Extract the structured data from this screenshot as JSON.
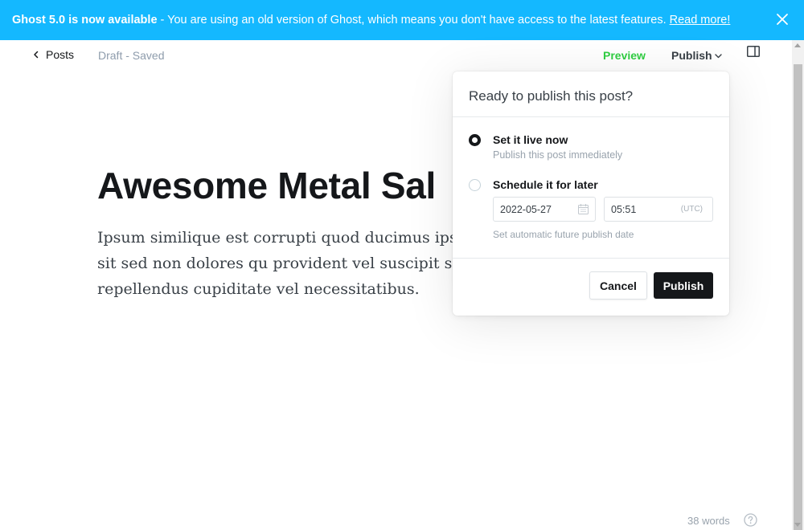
{
  "banner": {
    "bold_text": "Ghost 5.0 is now available",
    "text": " - You are using an old version of Ghost, which means you don't have access to the latest features.",
    "link": "Read more!",
    "close_icon": "close-icon",
    "background": "#14b8ff"
  },
  "header": {
    "back_label": "Posts",
    "status": "Draft - Saved",
    "preview_label": "Preview",
    "publish_label": "Publish",
    "sidebar_icon": "sidebar-toggle-icon"
  },
  "post": {
    "title": "Awesome Metal Sal",
    "body": "Ipsum similique est corrupti quod ducimus ipsum dolores quaerat est. Aliquid sit sed non dolores qu provident vel suscipit sit voluptatem voluptatem c repellendus cupiditate vel necessitatibus."
  },
  "publish_dropdown": {
    "title": "Ready to publish this post?",
    "options": [
      {
        "label": "Set it live now",
        "description": "Publish this post immediately",
        "selected": true
      },
      {
        "label": "Schedule it for later",
        "selected": false
      }
    ],
    "date_value": "2022-05-27",
    "time_value": "05:51",
    "timezone": "(UTC)",
    "schedule_note": "Set automatic future publish date",
    "cancel_label": "Cancel",
    "publish_label": "Publish"
  },
  "footer": {
    "word_count": "38 words",
    "help_icon": "help-icon"
  },
  "colors": {
    "accent_green": "#30cf43",
    "dark": "#15171a",
    "muted": "#8e9cac"
  }
}
